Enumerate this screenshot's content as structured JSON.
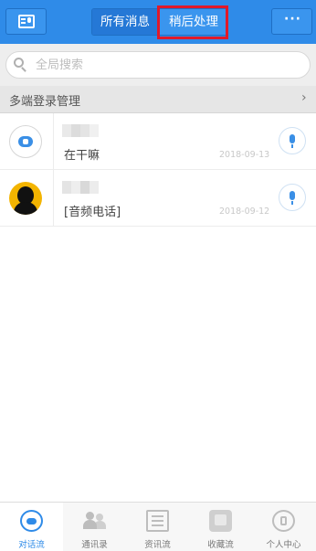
{
  "header": {
    "tabs": [
      {
        "label": "所有消息"
      },
      {
        "label": "稍后处理"
      }
    ],
    "left_icon": "contacts-voice-icon",
    "right_icon": "more-icon",
    "more_label": "···",
    "colors": {
      "bar": "#2f8be8",
      "highlight": "#e0192a"
    }
  },
  "search": {
    "placeholder": "全局搜索"
  },
  "multi_login": {
    "label": "多端登录管理",
    "chevron": "›"
  },
  "conversations": [
    {
      "preview": "在干嘛",
      "date": "2018-09-13",
      "avatar": "bot-avatar"
    },
    {
      "preview": "[音频电话]",
      "date": "2018-09-12",
      "avatar": "person-avatar"
    }
  ],
  "nav": {
    "items": [
      {
        "label": "对话流",
        "icon": "chat-bubble-icon",
        "active": true
      },
      {
        "label": "通讯录",
        "icon": "contacts-icon",
        "active": false
      },
      {
        "label": "资讯流",
        "icon": "news-icon",
        "active": false
      },
      {
        "label": "收藏流",
        "icon": "favorites-icon",
        "active": false
      },
      {
        "label": "个人中心",
        "icon": "profile-icon",
        "active": false
      }
    ]
  }
}
